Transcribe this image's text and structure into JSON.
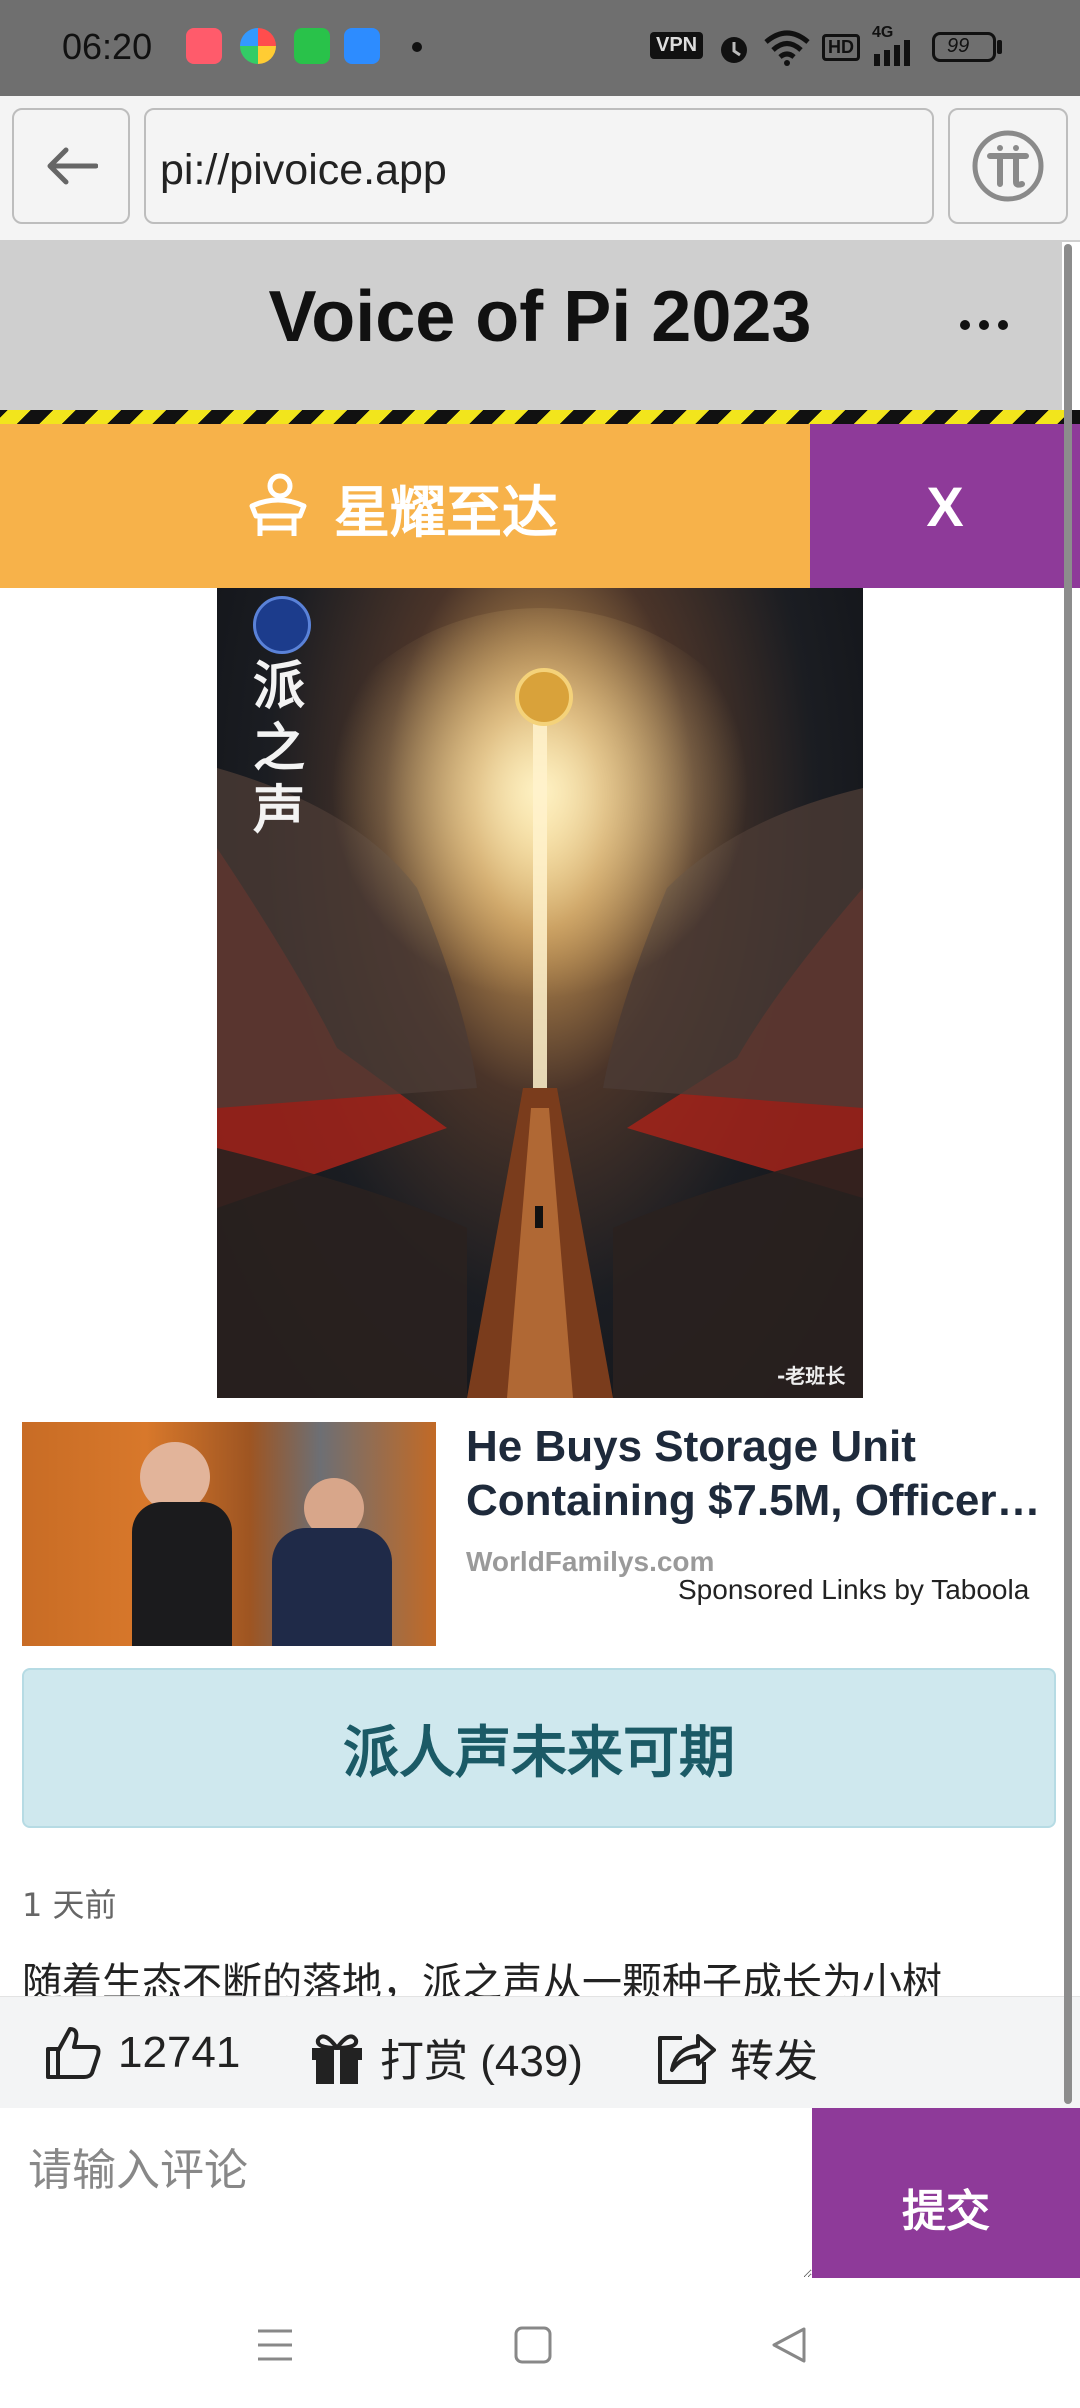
{
  "status_bar": {
    "time": "06:20",
    "vpn_label": "VPN",
    "hd_label": "HD",
    "network_label": "4G",
    "battery": "99",
    "icons": [
      "app-icon-1",
      "app-icon-2",
      "app-icon-3",
      "app-icon-4",
      "dot-icon",
      "vpn-icon",
      "alarm-icon",
      "wifi-icon",
      "hd-icon",
      "signal-icon",
      "battery-icon"
    ]
  },
  "browser": {
    "url": "pi://pivoice.app",
    "back_icon": "back-arrow-icon",
    "pi_icon": "pi-logo-icon"
  },
  "header": {
    "title": "Voice of Pi 2023",
    "menu_icon": "more-dots-icon"
  },
  "banner": {
    "label": "星耀至达",
    "close_label": "X",
    "icon": "desk-person-icon",
    "color": "#f7b24a",
    "close_color": "#8e3a99"
  },
  "poster": {
    "vertical_title": [
      "派",
      "之",
      "声"
    ],
    "credit": "-老班长",
    "logo_icon": "pi-logo-icon"
  },
  "ad": {
    "headline_line1": "He Buys Storage Unit",
    "headline_line2": "Containing $7.5M, Officer…",
    "source": "WorldFamilys.com",
    "sponsor": "Sponsored Links by Taboola"
  },
  "article": {
    "heading": "派人声未来可期",
    "time_ago": "1 天前",
    "body_first_line": "随着生态不断的落地，派之声从一颗种子成长为小树"
  },
  "actions": {
    "likes": "12741",
    "reward": "打赏 (439)",
    "share": "转发",
    "icons": [
      "thumbs-up-icon",
      "gift-icon",
      "share-icon"
    ]
  },
  "comment": {
    "placeholder": "请输入评论",
    "submit_label": "提交"
  },
  "nav": {
    "icons": [
      "menu-icon",
      "home-square-icon",
      "back-triangle-icon"
    ]
  }
}
